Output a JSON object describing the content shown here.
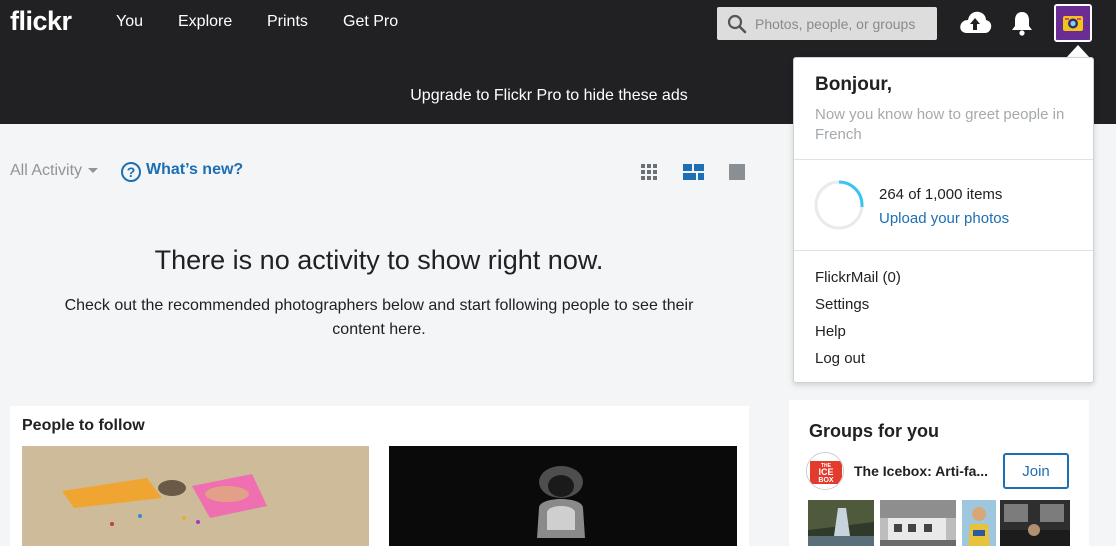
{
  "header": {
    "logo": "flickr",
    "nav": [
      "You",
      "Explore",
      "Prints",
      "Get Pro"
    ],
    "search_placeholder": "Photos, people, or groups",
    "icons": [
      "search-icon",
      "upload-cloud-icon",
      "bell-icon",
      "avatar"
    ]
  },
  "ad": {
    "text": "Upgrade to Flickr Pro to hide these ads"
  },
  "feed": {
    "filter_label": "All Activity",
    "whats_new": "What’s new?",
    "view_modes": [
      "grid-view-icon",
      "compact-view-icon",
      "single-view-icon"
    ],
    "active_view": "compact-view-icon",
    "empty_title": "There is no activity to show right now.",
    "empty_sub": "Check out the recommended photographers below and start following people to see their content here."
  },
  "people": {
    "title": "People to follow"
  },
  "groups": {
    "title": "Groups for you",
    "group_name": "The Icebox: Arti-fa...",
    "join_label": "Join",
    "logo_text": [
      "THE",
      "ICE",
      "BOX"
    ]
  },
  "dropdown": {
    "greeting": "Bonjour,",
    "tip": "Now you know how to greet people in French",
    "count": "264 of 1,000 items",
    "progress": 0.264,
    "upload_link": "Upload your photos",
    "menu": [
      "FlickrMail (0)",
      "Settings",
      "Help",
      "Log out"
    ]
  },
  "colors": {
    "nav_bg": "#212124",
    "page_bg": "#f3f5f6",
    "link_blue": "#1c6fb3",
    "progress_ring": "#3ac4f1"
  }
}
